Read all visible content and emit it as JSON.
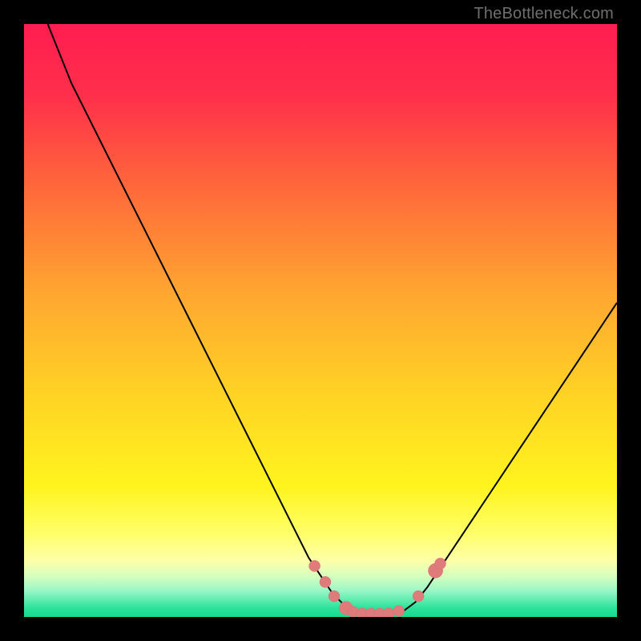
{
  "watermark": "TheBottleneck.com",
  "colors": {
    "bg": "#000000",
    "gradient_stops": [
      {
        "offset": 0.0,
        "color": "#ff1d50"
      },
      {
        "offset": 0.12,
        "color": "#ff2f4b"
      },
      {
        "offset": 0.28,
        "color": "#ff6a3a"
      },
      {
        "offset": 0.45,
        "color": "#ffa531"
      },
      {
        "offset": 0.62,
        "color": "#ffd225"
      },
      {
        "offset": 0.78,
        "color": "#fff41e"
      },
      {
        "offset": 0.86,
        "color": "#ffff6a"
      },
      {
        "offset": 0.905,
        "color": "#fdffa8"
      },
      {
        "offset": 0.93,
        "color": "#d8ffbe"
      },
      {
        "offset": 0.955,
        "color": "#9cf7c6"
      },
      {
        "offset": 0.985,
        "color": "#2be39b"
      },
      {
        "offset": 1.0,
        "color": "#14dc8e"
      }
    ],
    "curve": "#000000",
    "marker_fill": "#e07b7b",
    "marker_stroke": "#d86f6f"
  },
  "chart_data": {
    "type": "line",
    "title": "",
    "xlabel": "",
    "ylabel": "",
    "xlim": [
      0,
      100
    ],
    "ylim": [
      0,
      100
    ],
    "grid": false,
    "legend": false,
    "note": "Bottleneck curve. x≈normalized component ratio; y≈bottleneck % (0 at bottom, 100 at top). Values estimated from pixels.",
    "series": [
      {
        "name": "bottleneck-curve",
        "x": [
          4,
          6,
          8,
          10,
          12,
          14,
          16,
          18,
          20,
          22,
          24,
          26,
          28,
          30,
          32,
          34,
          36,
          38,
          40,
          42,
          44,
          46,
          48,
          50,
          52,
          54,
          56,
          58,
          60,
          62,
          64,
          66,
          68,
          70,
          74,
          78,
          82,
          86,
          90,
          94,
          98,
          100
        ],
        "y": [
          100,
          95,
          90,
          86,
          82,
          78,
          74,
          70,
          66,
          62,
          58,
          54,
          50,
          46,
          42,
          38,
          34,
          30,
          26,
          22,
          18,
          14,
          10,
          7,
          4,
          2,
          1,
          0.5,
          0.5,
          0.5,
          1,
          2.5,
          5,
          8,
          14,
          20,
          26,
          32,
          38,
          44,
          50,
          53
        ]
      }
    ],
    "markers": {
      "name": "highlight-points",
      "points": [
        {
          "x": 49.0,
          "y": 8.6,
          "r": 1.0
        },
        {
          "x": 50.8,
          "y": 5.9,
          "r": 1.0
        },
        {
          "x": 52.3,
          "y": 3.5,
          "r": 1.0
        },
        {
          "x": 54.3,
          "y": 1.5,
          "r": 1.2
        },
        {
          "x": 55.5,
          "y": 0.85,
          "r": 1.0
        },
        {
          "x": 57.0,
          "y": 0.6,
          "r": 1.0
        },
        {
          "x": 58.5,
          "y": 0.55,
          "r": 1.0
        },
        {
          "x": 60.0,
          "y": 0.55,
          "r": 1.0
        },
        {
          "x": 61.5,
          "y": 0.6,
          "r": 1.0
        },
        {
          "x": 63.2,
          "y": 1.0,
          "r": 1.0
        },
        {
          "x": 66.5,
          "y": 3.5,
          "r": 1.0
        },
        {
          "x": 69.4,
          "y": 7.8,
          "r": 1.3
        },
        {
          "x": 70.2,
          "y": 9.0,
          "r": 1.0
        }
      ]
    }
  }
}
